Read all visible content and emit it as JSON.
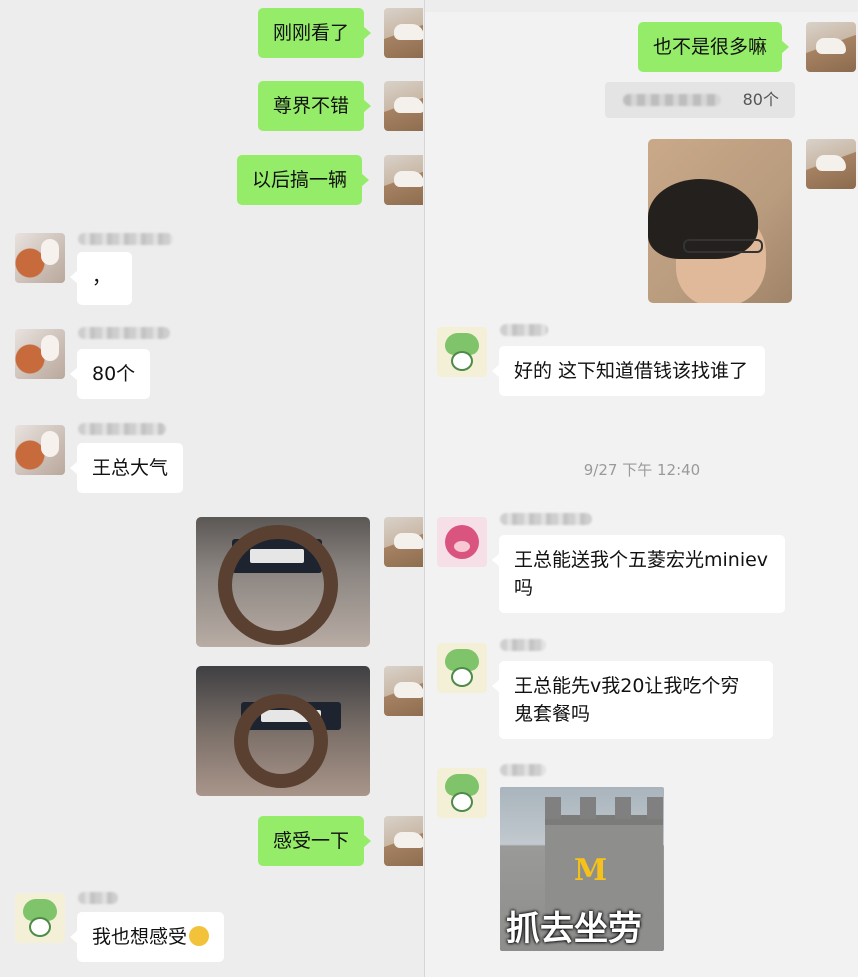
{
  "left_chat": {
    "messages": [
      {
        "text": "刚刚看了"
      },
      {
        "text": "尊界不错"
      },
      {
        "text": "以后搞一辆"
      },
      {
        "text": "，"
      },
      {
        "text": "80个"
      },
      {
        "text": "王总大气"
      },
      {
        "text": "感受一下"
      },
      {
        "text": "我也想感受"
      }
    ]
  },
  "right_chat": {
    "messages": [
      {
        "text": "也不是很多嘛"
      },
      {
        "text": "好的 这下知道借钱该找谁了"
      },
      {
        "text": "王总能送我个五菱宏光miniev吗"
      },
      {
        "text": "王总能先v我20让我吃个穷鬼套餐吗"
      }
    ],
    "reaction": {
      "count": "80个"
    },
    "timestamp": "9/27 下午 12:40",
    "meme": {
      "caption": "抓去坐劳",
      "logo": "M"
    }
  },
  "colors": {
    "my_bubble": "#95ec69",
    "other_bubble": "#ffffff",
    "background": "#ededed"
  }
}
